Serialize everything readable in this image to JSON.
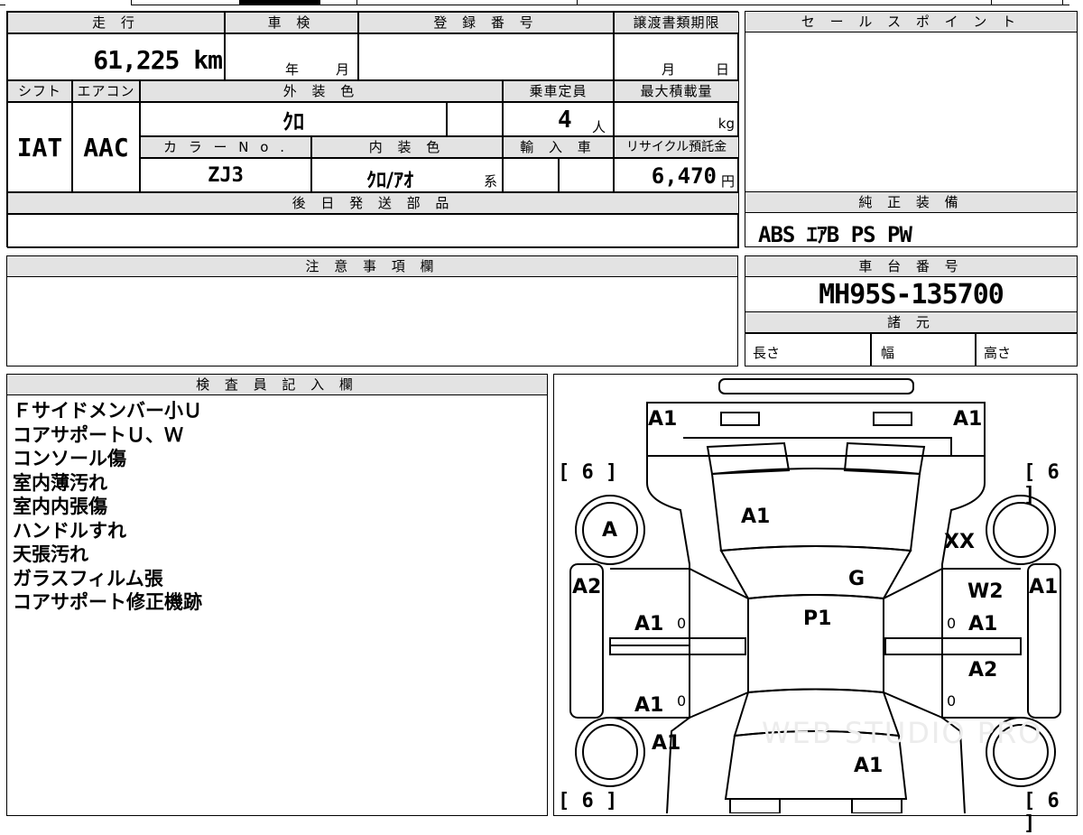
{
  "main_form": {
    "mileage_header": "走 行",
    "mileage_value": "61,225",
    "mileage_unit": "km",
    "inspection_header": "車 検",
    "inspection_year": "年",
    "inspection_month": "月",
    "registration_header": "登 録 番 号",
    "transfer_header": "譲渡書類期限",
    "transfer_month": "月",
    "transfer_day": "日",
    "shift_header": "シフト",
    "shift_value": "IAT",
    "ac_header": "エアコン",
    "ac_value": "AAC",
    "exterior_color_header": "外 装 色",
    "exterior_color_value": "ｸﾛ",
    "capacity_header": "乗車定員",
    "capacity_value": "4",
    "capacity_unit": "人",
    "max_load_header": "最大積載量",
    "max_load_unit": "kg",
    "color_no_header": "カ ラ ー N o .",
    "color_no_value": "ZJ3",
    "interior_color_header": "内 装 色",
    "interior_color_value": "ｸﾛ/ｱｵ",
    "interior_color_suffix": "系",
    "import_header": "輸 入 車",
    "recycle_header": "リサイクル預託金",
    "recycle_value": "6,470",
    "recycle_unit": "円",
    "later_parts_header": "後 日 発 送 部 品"
  },
  "sales_points": {
    "header": "セ ー ル ス ポ イ ン ト"
  },
  "standard_equipment": {
    "header": "純 正 装 備",
    "value": "ABS ｴｱB PS PW"
  },
  "notes": {
    "header": "注 意 事 項 欄"
  },
  "chassis": {
    "header": "車 台 番 号",
    "value": "MH95S-135700",
    "specs_header": "諸 元",
    "length": "長さ",
    "width": "幅",
    "height": "高さ"
  },
  "inspector": {
    "header": "検 査 員 記 入 欄",
    "lines": [
      "Ｆサイドメンバー小Ｕ",
      "コアサポートＵ、Ｗ",
      "コンソール傷",
      "室内薄汚れ",
      "室内内張傷",
      "ハンドルすれ",
      "天張汚れ",
      "ガラスフィルム張",
      "コアサポート修正機跡"
    ]
  },
  "diagram": {
    "marks": {
      "front_left": "A1",
      "front_right": "A1",
      "hood": "A1",
      "left_front_wheel": "A",
      "right_front": "XX",
      "left_fender": "A2",
      "right_fender": "A1",
      "windshield": "G",
      "right_front_door": "W2",
      "left_front_door": "A1",
      "roof": "P1",
      "right_front_door_lower": "A1",
      "right_rear_door": "A2",
      "left_rear_door": "A1",
      "left_rear": "A1",
      "rear": "A1"
    },
    "tire_top_left": "[ 6 ]",
    "tire_top_right": "[ 6 ]",
    "tire_bottom_left": "[ 6 ]",
    "tire_bottom_right": "[ 6 ]",
    "zero_mark": "0",
    "watermark": "WEB STUDIO PRO"
  }
}
